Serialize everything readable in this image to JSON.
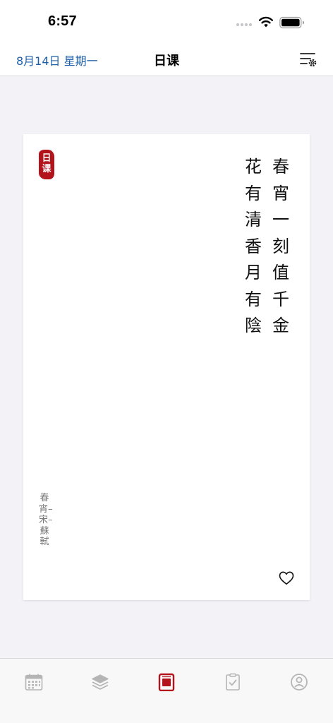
{
  "status_bar": {
    "time": "6:57",
    "icons": [
      "cellular-signal-icon",
      "wifi-icon",
      "battery-icon"
    ]
  },
  "nav": {
    "date": "8月14日 星期一",
    "title": "日课",
    "settings_icon": "list-settings-icon"
  },
  "card": {
    "seal_text": "日课",
    "poem_lines": [
      "春宵一刻值千金",
      "花有清香月有陰"
    ],
    "attribution": "春宵–宋–蘇軾",
    "favorite_icon": "heart-icon"
  },
  "tab_bar": {
    "tabs": [
      {
        "icon": "calendar-icon",
        "active": false
      },
      {
        "icon": "layers-icon",
        "active": false
      },
      {
        "icon": "daily-card-icon",
        "active": true
      },
      {
        "icon": "checklist-icon",
        "active": false
      },
      {
        "icon": "profile-icon",
        "active": false
      }
    ]
  },
  "colors": {
    "accent_red": "#b3141b",
    "date_blue": "#1d5fa8",
    "background": "#f2f2f7",
    "inactive_icon": "#b5b5b5"
  }
}
